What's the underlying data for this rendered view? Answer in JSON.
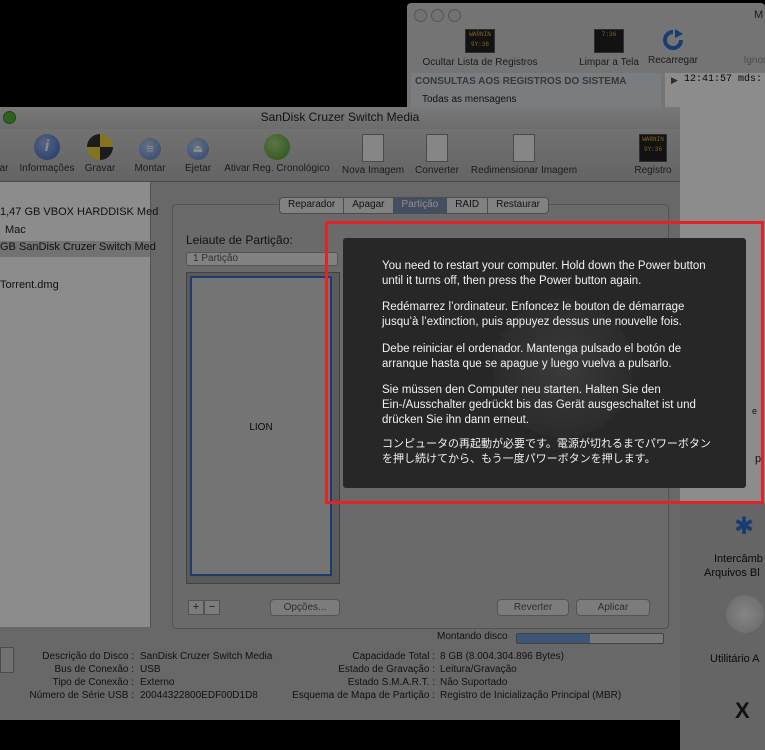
{
  "console": {
    "title_fragment": "M",
    "toolbar": [
      {
        "label": "Ocultar Lista de Registros",
        "icon": "log-icon",
        "icon_text": "WARNIN\n9Y:36"
      },
      {
        "label": "Limpar a Tela",
        "icon": "broom-log-icon",
        "icon_text": "7:36"
      },
      {
        "label": "Recarregar",
        "icon": "reload-icon"
      },
      {
        "label": "Ignor",
        "icon": "ignore-icon"
      }
    ],
    "section_header": "CONSULTAS AOS REGISTROS DO SISTEMA",
    "query_item": "Todas as mensagens",
    "log_line": "12:41:57 mds:"
  },
  "window": {
    "title": "SanDisk Cruzer Switch Media",
    "toolbar": [
      {
        "label": "ar",
        "icon": "verify-icon"
      },
      {
        "label": "Informações",
        "icon": "info-icon"
      },
      {
        "label": "Gravar",
        "icon": "burn-icon"
      },
      {
        "label": "Montar",
        "icon": "mount-icon"
      },
      {
        "label": "Ejetar",
        "icon": "eject-icon"
      },
      {
        "label": "Ativar Reg. Cronológico",
        "icon": "journal-icon"
      },
      {
        "label": "Nova Imagem",
        "icon": "new-image-icon"
      },
      {
        "label": "Converter",
        "icon": "convert-icon"
      },
      {
        "label": "Redimensionar Imagem",
        "icon": "resize-image-icon"
      },
      {
        "label": "Registro",
        "icon": "log-icon",
        "icon_text": "WARNIN\n9Y:36"
      }
    ],
    "disks": [
      {
        "label": "1,47 GB VBOX HARDDISK Med"
      },
      {
        "label": "Mac"
      },
      {
        "label": "GB SanDisk Cruzer Switch Med"
      },
      {
        "label": "Torrent.dmg"
      }
    ],
    "tabs": [
      "Reparador",
      "Apagar",
      "Partição",
      "RAID",
      "Restaurar"
    ],
    "active_tab": "Partição",
    "layout_label": "Leiaute de Partição:",
    "layout_select": "1 Partição",
    "partition_name": "LION",
    "add_btn": "+",
    "remove_btn": "−",
    "options_btn": "Opções...",
    "revert_btn": "Reverter",
    "apply_btn": "Aplicar",
    "status_text": "Montando disco",
    "progress": 0.5,
    "info_left": [
      {
        "key": "Descrição do Disco :",
        "value": "SanDisk Cruzer Switch Media"
      },
      {
        "key": "Bus de Conexão :",
        "value": "USB"
      },
      {
        "key": "Tipo de Conexão :",
        "value": "Externo"
      },
      {
        "key": "Número de Série USB :",
        "value": "20044322800EDF00D1D8"
      }
    ],
    "info_right": [
      {
        "key": "Capacidade Total :",
        "value": "8 GB (8.004.304.896 Bytes)"
      },
      {
        "key": "Estado de Gravação :",
        "value": "Leitura/Gravação"
      },
      {
        "key": "Estado S.M.A.R.T. :",
        "value": "Não Suportado"
      },
      {
        "key": "Esquema de Mapa de Partição :",
        "value": "Registro de Inicialização Principal (MBR)"
      }
    ]
  },
  "background_right": {
    "fragment_1": "e",
    "fragment_2": "pt",
    "item1": "Intercâmb",
    "item1_line2": "Arquivos Bl",
    "item2": "Utilitário A",
    "item3": "X"
  },
  "panic": {
    "en": "You need to restart your computer. Hold down the Power button until it turns off, then press the Power button again.",
    "fr": "Redémarrez l’ordinateur. Enfoncez le bouton de démarrage jusqu’à l’extinction, puis appuyez dessus une nouvelle fois.",
    "es": "Debe reiniciar el ordenador. Mantenga pulsado el botón de arranque hasta que se apague y luego vuelva a pulsarlo.",
    "de": "Sie müssen den Computer neu starten. Halten Sie den Ein-/Ausschalter gedrückt bis das Gerät ausgeschaltet ist und drücken Sie ihn dann erneut.",
    "ja": "コンピュータの再起動が必要です。電源が切れるまでパワーボタンを押し続けてから、もう一度パワーボタンを押します。"
  },
  "colors": {
    "highlight": "#e3232a",
    "tab_active": "#7d8eb3",
    "panic_bg": "#272727"
  }
}
